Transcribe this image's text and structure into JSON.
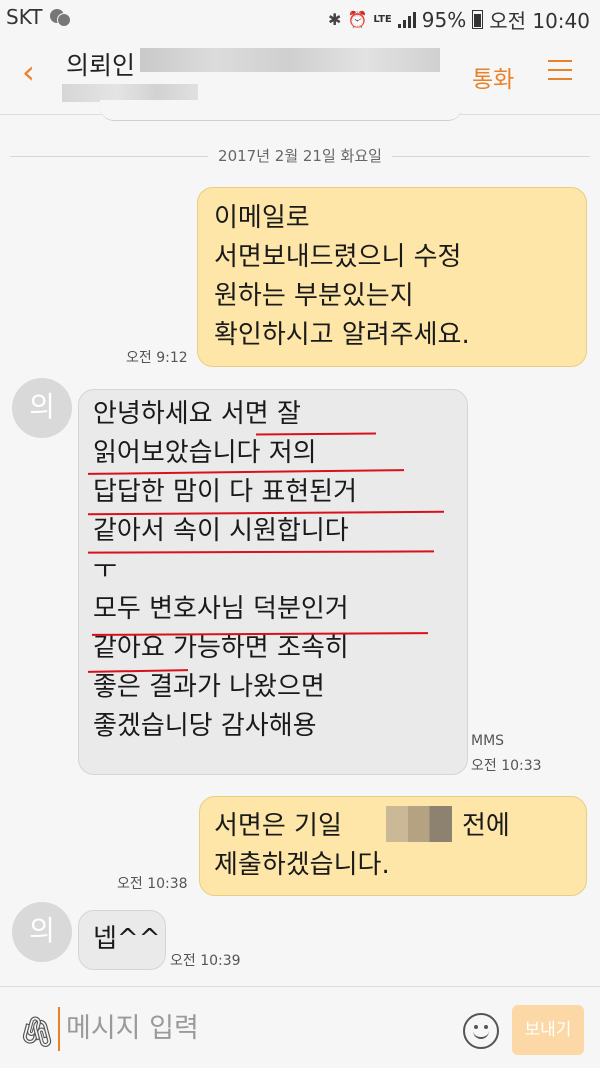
{
  "status": {
    "carrier": "SKT",
    "network": "LTE",
    "battery": "95%",
    "time": "오전 10:40"
  },
  "header": {
    "back_icon": "chevron-left-icon",
    "contact_name": "의뢰인",
    "call_label": "통화",
    "menu_icon": "hamburger-menu-icon",
    "accent": "#e8812a"
  },
  "date_separator": "2017년 2월 21일 화요일",
  "messages": [
    {
      "direction": "sent",
      "lines": [
        "이메일로",
        "서면보내드렸으니  수정",
        "원하는 부분있는지",
        "확인하시고 알려주세요."
      ],
      "time": "오전 9:12"
    },
    {
      "direction": "received",
      "avatar": "의",
      "lines": [
        "안녕하세요 서면 잘",
        "읽어보았습니다 저의",
        "답답한 맘이 다 표현된거",
        "같아서 속이 시원합니다",
        "ㅜ",
        "모두 변호사님 덕분인거",
        "같아요 가능하면 조속히",
        "좋은 결과가 나왔으면",
        "좋겠습니당 감사해용"
      ],
      "type_label": "MMS",
      "time": "오전 10:33"
    },
    {
      "direction": "sent",
      "lines": [
        "서면은 기일",
        "전에",
        "제출하겠습니다."
      ],
      "time": "오전 10:38"
    },
    {
      "direction": "received",
      "avatar": "의",
      "lines": [
        "넵^^"
      ],
      "time": "오전 10:39"
    }
  ],
  "composer": {
    "attach_icon": "paperclip-icon",
    "placeholder": "메시지 입력",
    "emoji_icon": "smiley-icon",
    "send_label": "보내기"
  }
}
